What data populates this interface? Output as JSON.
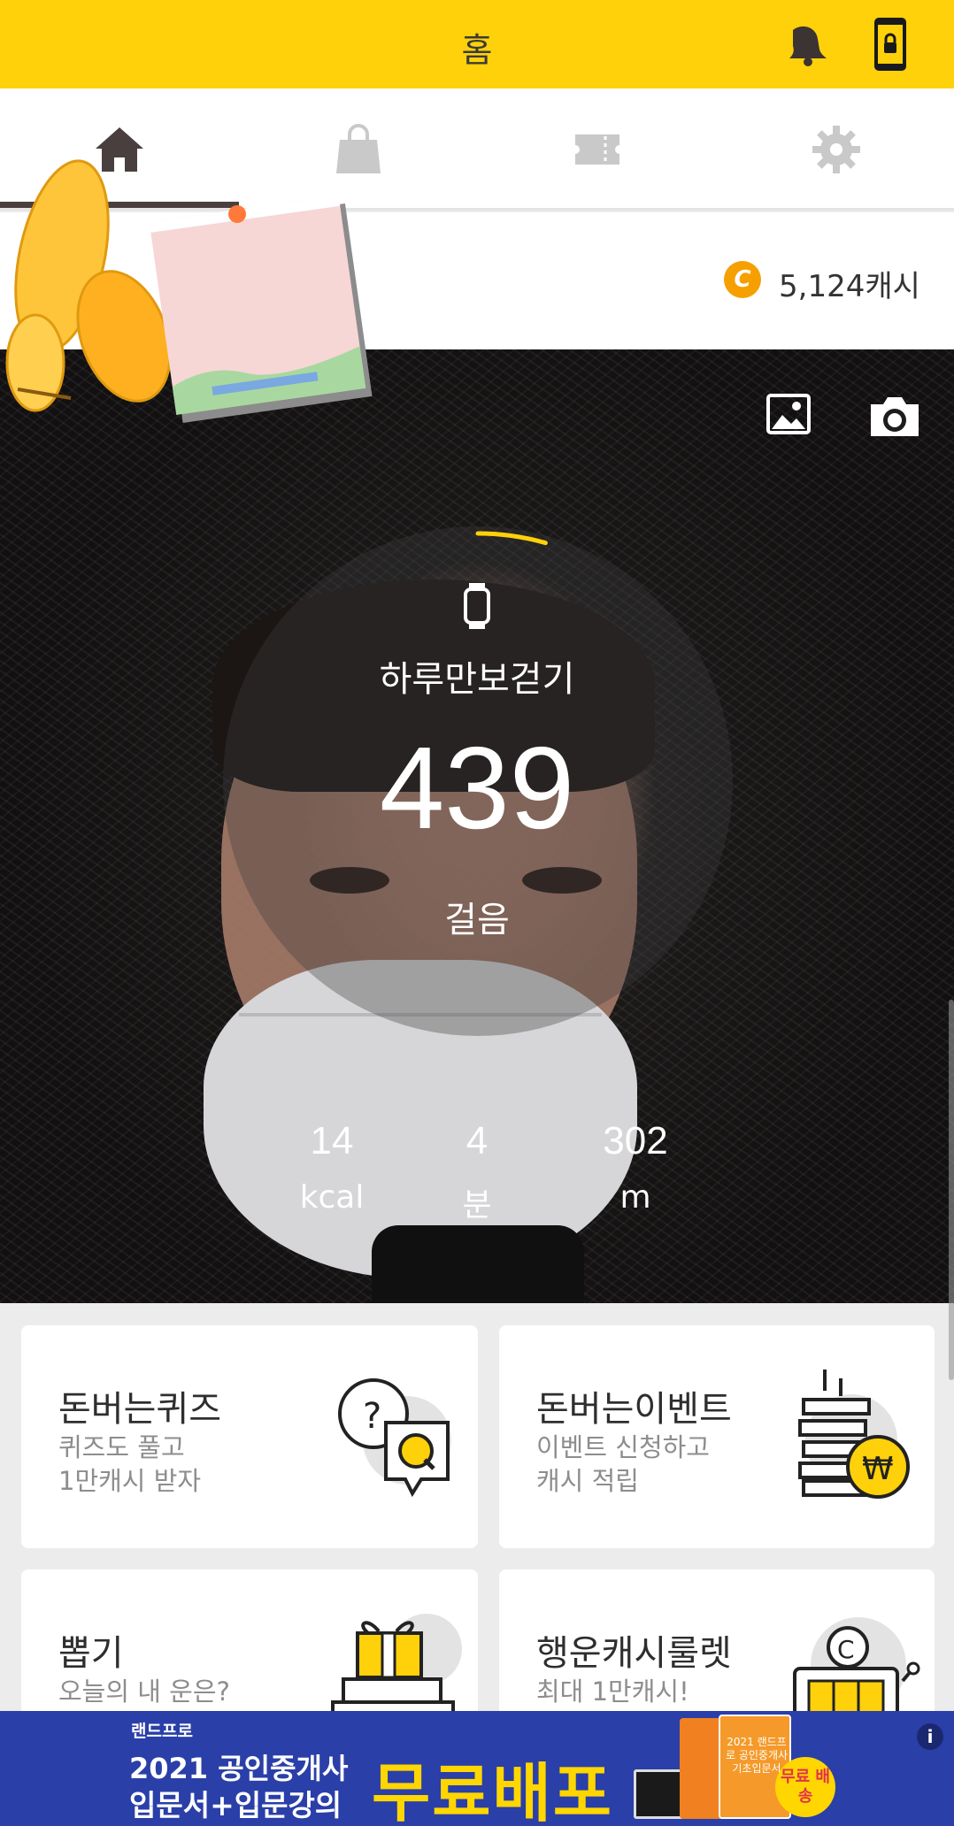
{
  "header": {
    "title": "홈"
  },
  "tabs": [
    {
      "name": "home",
      "active": true
    },
    {
      "name": "shop",
      "active": false
    },
    {
      "name": "ticket",
      "active": false
    },
    {
      "name": "settings",
      "active": false
    }
  ],
  "cash": {
    "amount": "5,124캐시",
    "coin_symbol": "C"
  },
  "walker": {
    "label": "하루만보걷기",
    "steps": "439",
    "unit": "걸음",
    "progress": 0.044,
    "stats": [
      {
        "value": "14",
        "unit": "kcal"
      },
      {
        "value": "4",
        "unit": "분"
      },
      {
        "value": "302",
        "unit": "m"
      }
    ]
  },
  "cards": [
    {
      "title": "돈버는퀴즈",
      "sub1": "퀴즈도 풀고",
      "sub2": "1만캐시 받자",
      "icon": "quiz-icon"
    },
    {
      "title": "돈버는이벤트",
      "sub1": "이벤트 신청하고",
      "sub2": "캐시 적립",
      "icon": "coin-stack-icon"
    },
    {
      "title": "뽑기",
      "sub1": "오늘의 내 운은?",
      "sub2": "",
      "icon": "gift-icon"
    },
    {
      "title": "행운캐시룰렛",
      "sub1": "최대 1만캐시!",
      "sub2": "",
      "icon": "slot-machine-icon"
    }
  ],
  "ad": {
    "brand": "랜드프로",
    "line1": "2021 공인중개사",
    "line2": "입문서+입문강의",
    "headline": "무료배포",
    "book_text": "2021 랜드프로 공인중개사 기초입문서",
    "badge": "무료 배송",
    "info": "i"
  },
  "colors": {
    "accent": "#ffd10a",
    "coin": "#f5a000",
    "ad_bg": "#2a3fa8",
    "ad_headline": "#ffd600"
  }
}
